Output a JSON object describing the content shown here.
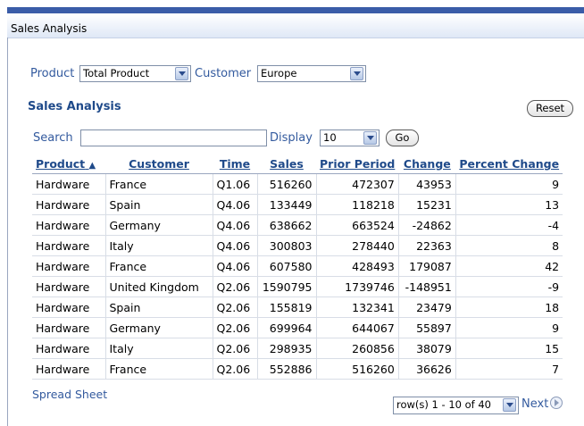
{
  "region": {
    "title": "Sales Analysis"
  },
  "filters": {
    "product_label": "Product",
    "product_value": "Total Product",
    "customer_label": "Customer",
    "customer_value": "Europe"
  },
  "report": {
    "title": "Sales Analysis",
    "reset_label": "Reset",
    "search_label": "Search",
    "search_value": "",
    "display_label": "Display",
    "display_value": "10",
    "go_label": "Go",
    "columns": [
      "Product",
      "Customer",
      "Time",
      "Sales",
      "Prior Period",
      "Change",
      "Percent Change"
    ],
    "sort_indicator": "▲",
    "rows": [
      [
        "Hardware",
        "France",
        "Q1.06",
        "516260",
        "472307",
        "43953",
        "9"
      ],
      [
        "Hardware",
        "Spain",
        "Q4.06",
        "133449",
        "118218",
        "15231",
        "13"
      ],
      [
        "Hardware",
        "Germany",
        "Q4.06",
        "638662",
        "663524",
        "-24862",
        "-4"
      ],
      [
        "Hardware",
        "Italy",
        "Q4.06",
        "300803",
        "278440",
        "22363",
        "8"
      ],
      [
        "Hardware",
        "France",
        "Q4.06",
        "607580",
        "428493",
        "179087",
        "42"
      ],
      [
        "Hardware",
        "United Kingdom",
        "Q2.06",
        "1590795",
        "1739746",
        "-148951",
        "-9"
      ],
      [
        "Hardware",
        "Spain",
        "Q2.06",
        "155819",
        "132341",
        "23479",
        "18"
      ],
      [
        "Hardware",
        "Germany",
        "Q2.06",
        "699964",
        "644067",
        "55897",
        "9"
      ],
      [
        "Hardware",
        "Italy",
        "Q2.06",
        "298935",
        "260856",
        "38079",
        "15"
      ],
      [
        "Hardware",
        "France",
        "Q2.06",
        "552886",
        "516260",
        "36626",
        "7"
      ]
    ],
    "spreadsheet_link": "Spread Sheet",
    "pagination_value": "row(s) 1 - 10 of 40",
    "next_label": "Next"
  },
  "colors": {
    "accent": "#3a5ca8",
    "link": "#335a9e",
    "header_text": "#1f4a8a"
  }
}
